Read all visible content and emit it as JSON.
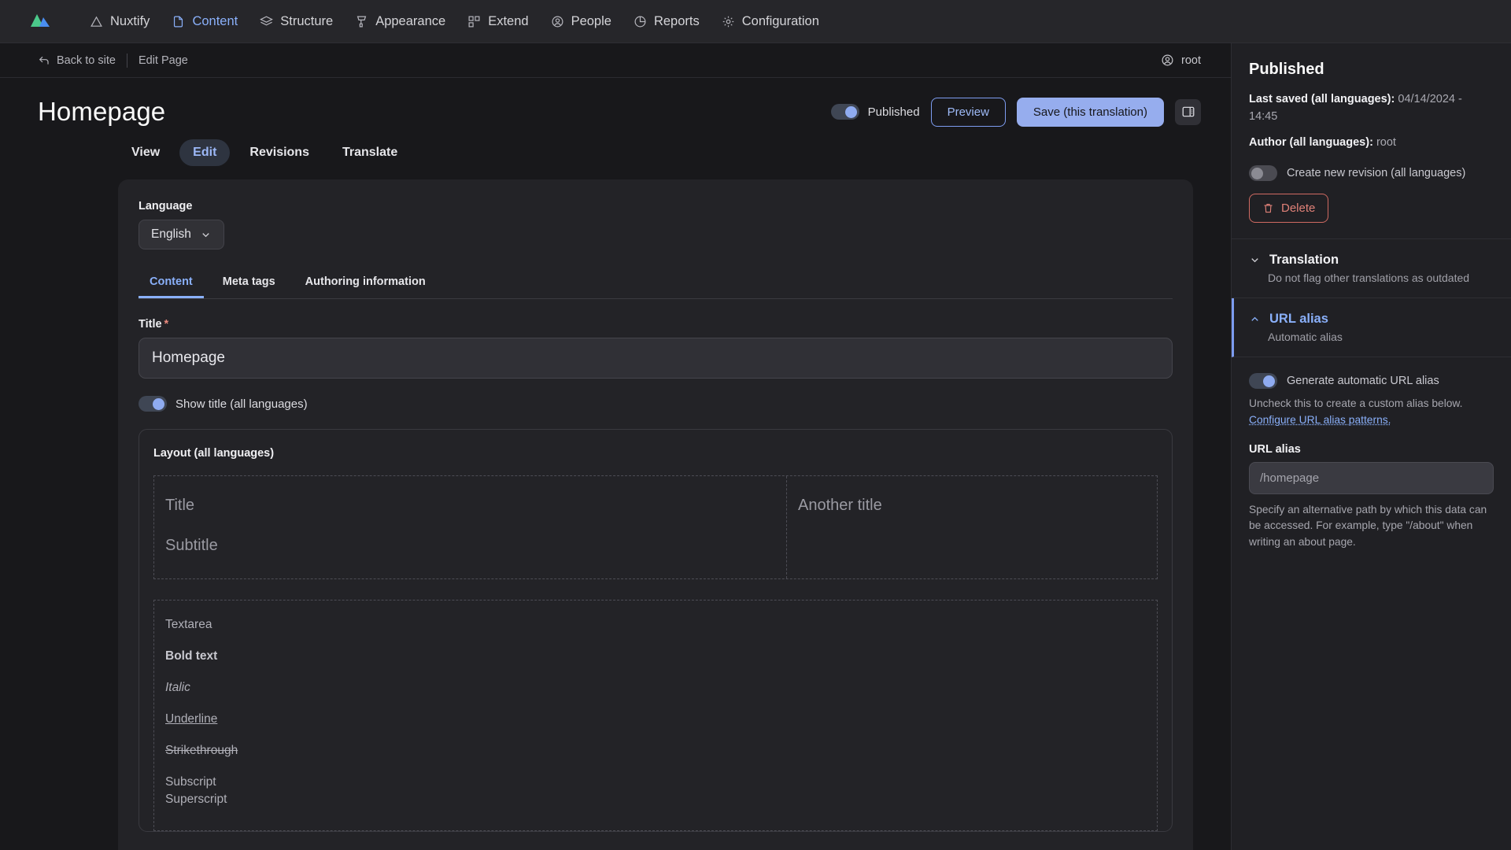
{
  "topnav": {
    "logo": "nuxtify-logo",
    "items": [
      {
        "label": "Nuxtify",
        "icon": "mountain-icon",
        "active": false
      },
      {
        "label": "Content",
        "icon": "file-icon",
        "active": true
      },
      {
        "label": "Structure",
        "icon": "layers-icon",
        "active": false
      },
      {
        "label": "Appearance",
        "icon": "brush-icon",
        "active": false
      },
      {
        "label": "Extend",
        "icon": "blocks-icon",
        "active": false
      },
      {
        "label": "People",
        "icon": "user-circle-icon",
        "active": false
      },
      {
        "label": "Reports",
        "icon": "pie-chart-icon",
        "active": false
      },
      {
        "label": "Configuration",
        "icon": "gear-icon",
        "active": false
      }
    ]
  },
  "breadcrumb": {
    "back_label": "Back to site",
    "back_icon": "arrow-back-icon",
    "current": "Edit Page",
    "user": "root",
    "user_icon": "user-circle-icon"
  },
  "page": {
    "title": "Homepage",
    "published_toggle_label": "Published",
    "published_toggle_on": true,
    "preview_label": "Preview",
    "save_label": "Save (this translation)",
    "panel_toggle_icon": "panel-right-icon"
  },
  "primary_tabs": [
    {
      "label": "View",
      "active": false
    },
    {
      "label": "Edit",
      "active": true
    },
    {
      "label": "Revisions",
      "active": false
    },
    {
      "label": "Translate",
      "active": false
    }
  ],
  "form": {
    "language_label": "Language",
    "language_value": "English",
    "language_chevron": "chevron-down-icon",
    "sub_tabs": [
      {
        "label": "Content",
        "active": true
      },
      {
        "label": "Meta tags",
        "active": false
      },
      {
        "label": "Authoring information",
        "active": false
      }
    ],
    "title_label": "Title",
    "title_required_marker": "*",
    "title_value": "Homepage",
    "show_title_label": "Show title (all languages)",
    "show_title_on": true,
    "layout_legend": "Layout (all languages)",
    "layout_placeholders": {
      "title": "Title",
      "subtitle": "Subtitle",
      "another_title": "Another title"
    },
    "format_samples": {
      "textarea": "Textarea",
      "bold": "Bold text",
      "italic": "Italic",
      "underline": "Underline",
      "strikethrough": "Strikethrough",
      "subscript": "Subscript",
      "superscript": "Superscript"
    }
  },
  "sidebar": {
    "status_title": "Published",
    "last_saved_label": "Last saved (all languages):",
    "last_saved_value": "04/14/2024 - 14:45",
    "author_label": "Author (all languages):",
    "author_value": "root",
    "new_revision_label": "Create new revision (all languages)",
    "new_revision_on": false,
    "delete_label": "Delete",
    "delete_icon": "trash-icon",
    "sections": [
      {
        "title": "Translation",
        "summary": "Do not flag other translations as outdated",
        "expanded": false,
        "chevron": "chevron-down-icon"
      },
      {
        "title": "URL alias",
        "summary": "Automatic alias",
        "expanded": true,
        "chevron": "chevron-up-icon"
      }
    ],
    "url_alias": {
      "generate_label": "Generate automatic URL alias",
      "generate_on": true,
      "help": "Uncheck this to create a custom alias below.",
      "link": "Configure URL alias patterns.",
      "field_label": "URL alias",
      "placeholder": "/homepage",
      "description": "Specify an alternative path by which this data can be accessed. For example, type \"/about\" when writing an about page."
    }
  },
  "colors": {
    "accent": "#8ab0fa",
    "primary_button": "#96adee",
    "danger": "#e08178",
    "required": "#ea8a7e"
  }
}
